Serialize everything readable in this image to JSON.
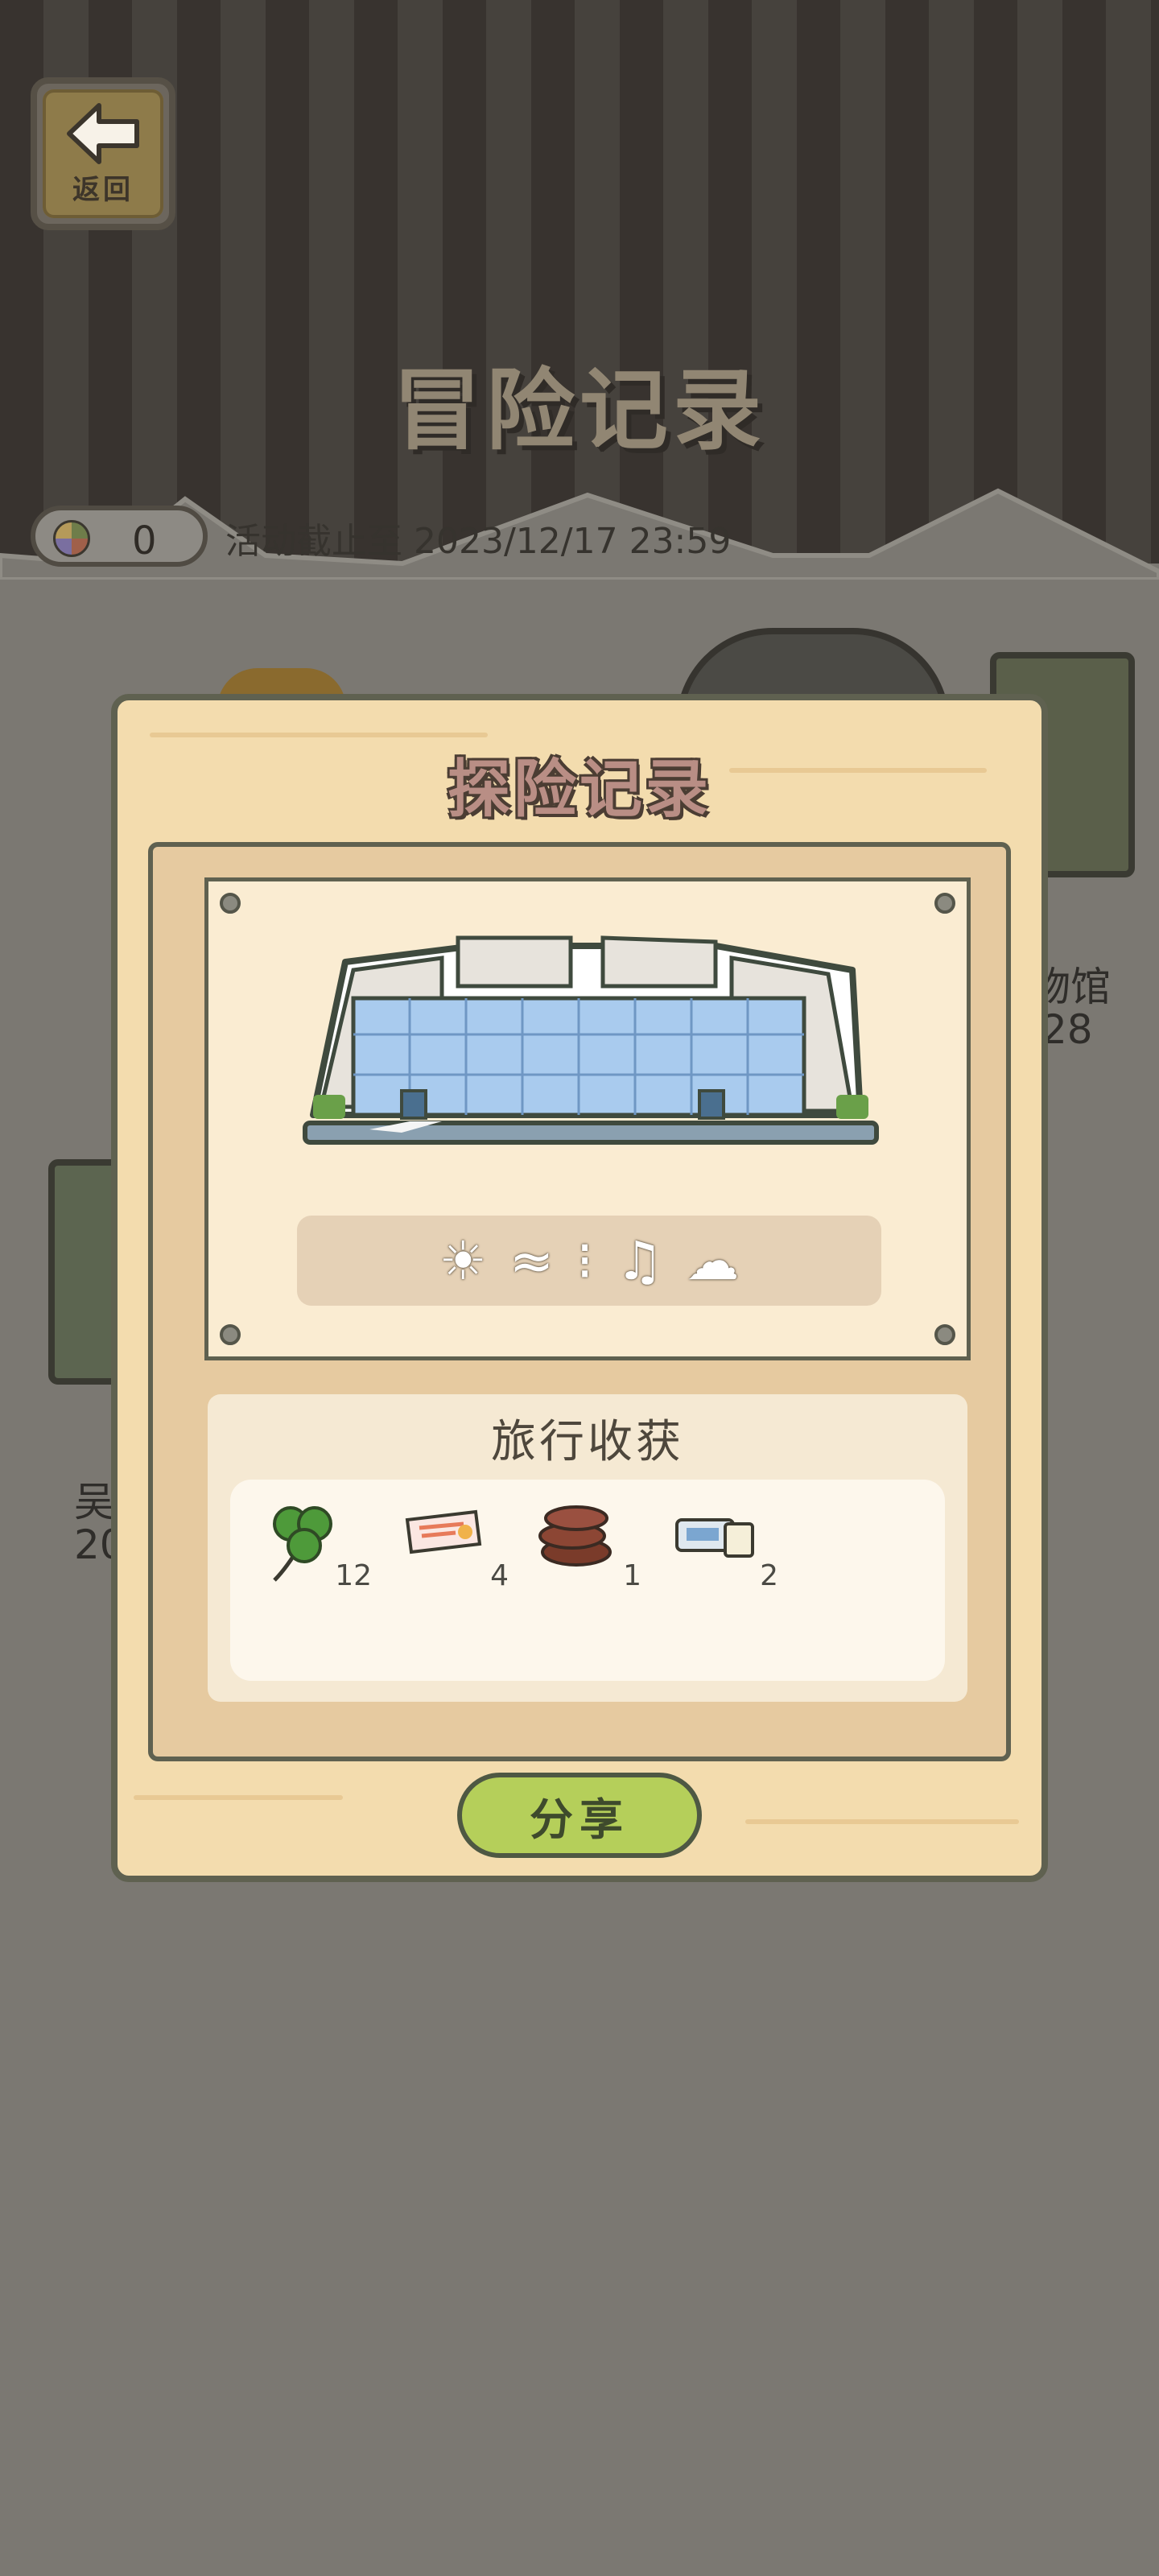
{
  "header": {
    "back_label": "返回",
    "title": "冒险记录"
  },
  "status": {
    "coin_count": "0",
    "deadline": "活动截止至 2023/12/17 23:59"
  },
  "background_cards": {
    "right_text_line1": "物馆",
    "right_text_line2": "28",
    "left_text_line1": "吴",
    "left_text_line2": "20"
  },
  "modal": {
    "title": "探险记录",
    "weather_icons": [
      "sun-icon",
      "wind-icon",
      "sparkle-icon",
      "music-note-icon",
      "wing-icon"
    ],
    "rewards": {
      "title": "旅行收获",
      "items": [
        {
          "icon": "clover-icon",
          "count": "12"
        },
        {
          "icon": "ticket-icon",
          "count": "4"
        },
        {
          "icon": "chocolate-roll-icon",
          "count": "1"
        },
        {
          "icon": "pass-card-icon",
          "count": "2"
        }
      ]
    },
    "share_label": "分享"
  },
  "colors": {
    "modal_bg": "#f3dcae",
    "share_button": "#b5cf5a",
    "border": "#5f6150"
  }
}
